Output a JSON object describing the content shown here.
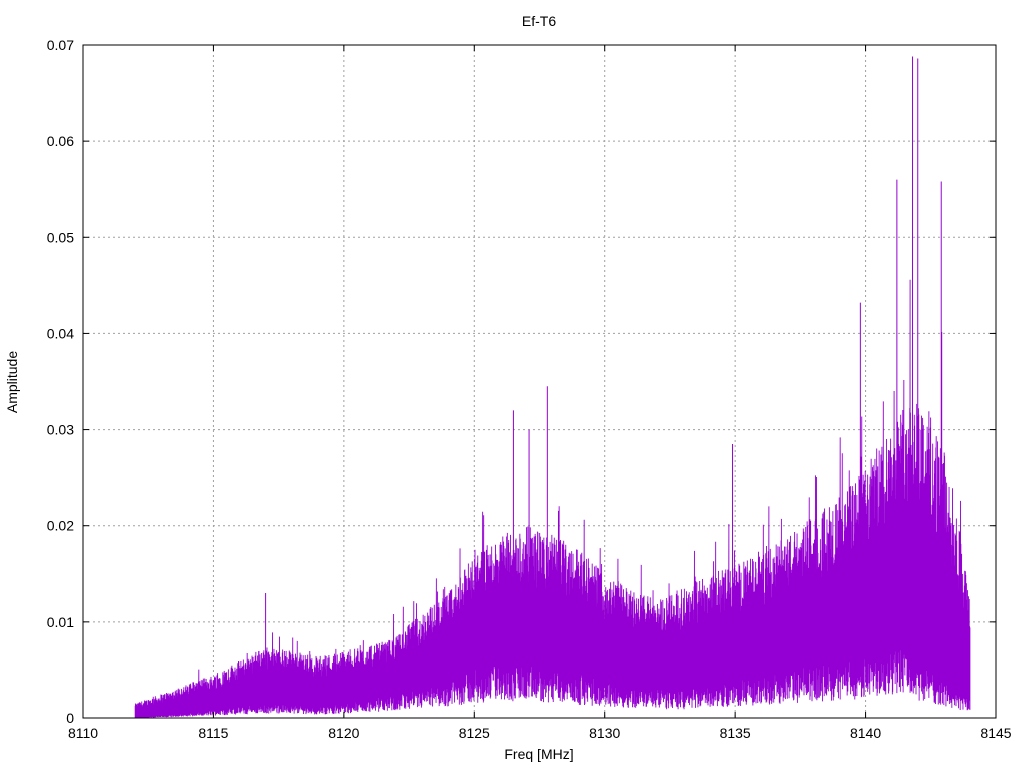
{
  "chart_data": {
    "type": "line",
    "title": "Ef-T6",
    "xlabel": "Freq [MHz]",
    "ylabel": "Amplitude",
    "xlim": [
      8110,
      8145
    ],
    "ylim": [
      0,
      0.07
    ],
    "x_ticks": [
      8110,
      8115,
      8120,
      8125,
      8130,
      8135,
      8140,
      8145
    ],
    "y_ticks": [
      0,
      0.01,
      0.02,
      0.03,
      0.04,
      0.05,
      0.06,
      0.07
    ],
    "x_tick_labels": [
      "8110",
      "8115",
      "8120",
      "8125",
      "8130",
      "8135",
      "8140",
      "8145"
    ],
    "y_tick_labels": [
      "0",
      "0.01",
      "0.02",
      "0.03",
      "0.04",
      "0.05",
      "0.06",
      "0.07"
    ],
    "grid": true,
    "series": [
      {
        "color": "#9400d3",
        "envelope": {
          "x": [
            8112.0,
            8113.0,
            8114.0,
            8115.0,
            8116.0,
            8117.0,
            8118.0,
            8119.0,
            8120.0,
            8121.0,
            8122.0,
            8123.0,
            8124.0,
            8125.0,
            8126.0,
            8127.0,
            8128.0,
            8129.0,
            8130.0,
            8131.0,
            8132.0,
            8133.0,
            8134.0,
            8135.0,
            8136.0,
            8137.0,
            8138.0,
            8139.0,
            8140.0,
            8141.0,
            8141.5,
            8142.0,
            8142.5,
            8143.0,
            8143.5,
            8144.0
          ],
          "upper": [
            0.0015,
            0.0025,
            0.0035,
            0.0045,
            0.006,
            0.0075,
            0.007,
            0.0065,
            0.007,
            0.0075,
            0.0085,
            0.011,
            0.013,
            0.017,
            0.019,
            0.02,
            0.019,
            0.018,
            0.015,
            0.0135,
            0.0125,
            0.0135,
            0.015,
            0.016,
            0.017,
            0.019,
            0.021,
            0.023,
            0.026,
            0.031,
            0.033,
            0.034,
            0.032,
            0.028,
            0.022,
            0.012
          ],
          "lower": [
            0.0,
            0.0002,
            0.0005,
            0.0008,
            0.0012,
            0.0015,
            0.0015,
            0.0012,
            0.0015,
            0.002,
            0.0025,
            0.003,
            0.004,
            0.005,
            0.006,
            0.0055,
            0.005,
            0.0045,
            0.004,
            0.0035,
            0.003,
            0.003,
            0.0035,
            0.004,
            0.0045,
            0.005,
            0.0055,
            0.006,
            0.0065,
            0.008,
            0.008,
            0.006,
            0.005,
            0.004,
            0.003,
            0.002
          ]
        },
        "peaks": [
          {
            "x": 8117.0,
            "y": 0.013
          },
          {
            "x": 8126.5,
            "y": 0.032
          },
          {
            "x": 8127.1,
            "y": 0.03
          },
          {
            "x": 8127.8,
            "y": 0.0345
          },
          {
            "x": 8134.9,
            "y": 0.0285
          },
          {
            "x": 8139.8,
            "y": 0.0432
          },
          {
            "x": 8141.2,
            "y": 0.056
          },
          {
            "x": 8141.8,
            "y": 0.0688
          },
          {
            "x": 8142.0,
            "y": 0.0686
          },
          {
            "x": 8142.9,
            "y": 0.0558
          }
        ]
      }
    ]
  }
}
